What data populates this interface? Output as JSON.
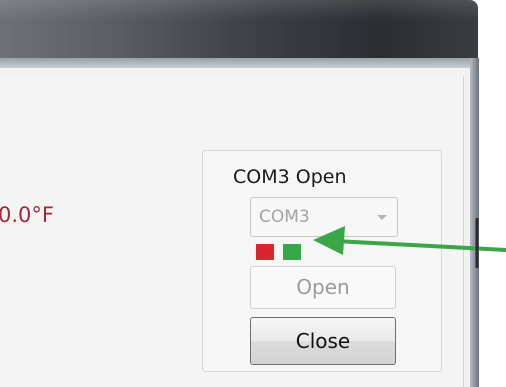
{
  "window": {
    "partial_label": "",
    "temperature_reading": "0.0°F"
  },
  "com_group": {
    "status_label": "COM3 Open",
    "port_select": {
      "value": "COM3",
      "arrow_icon": "chevron-down-icon"
    },
    "indicators": [
      {
        "name": "disconnected-indicator",
        "color": "#d9252f"
      },
      {
        "name": "connected-indicator",
        "color": "#34a846"
      }
    ],
    "open_button_label": "Open",
    "close_button_label": "Close"
  },
  "annotation": {
    "arrow_icon": "arrow-left-icon",
    "color": "#3aa648"
  }
}
